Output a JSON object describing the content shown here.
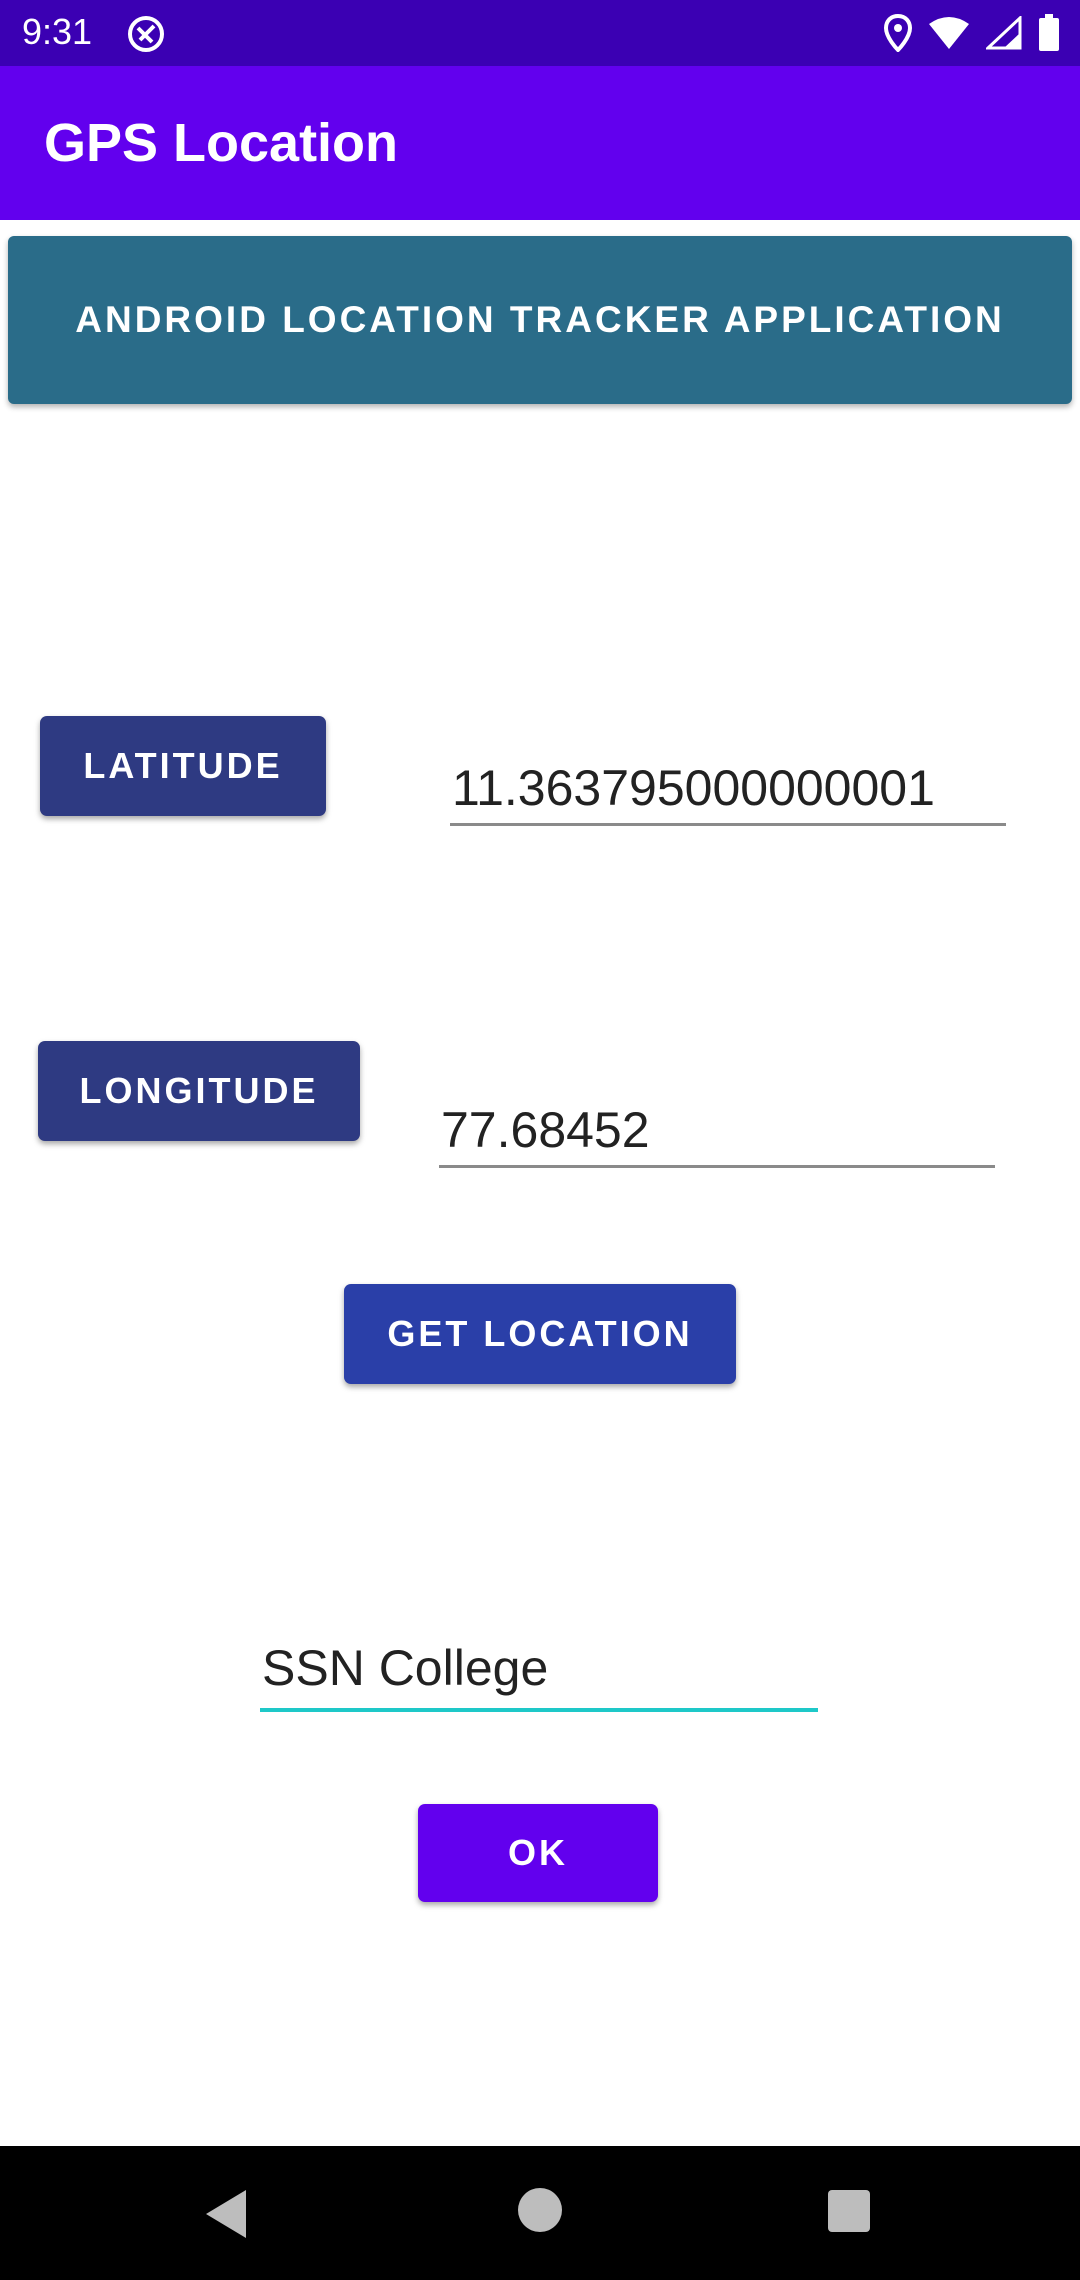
{
  "status_bar": {
    "time": "9:31",
    "icons": [
      "app-notification-icon",
      "location-icon",
      "wifi-icon",
      "signal-icon",
      "battery-icon"
    ]
  },
  "app_bar": {
    "title": "GPS Location",
    "color": "#6200ee"
  },
  "banner": {
    "label": "ANDROID LOCATION TRACKER APPLICATION",
    "color": "#2a6c89"
  },
  "latitude": {
    "button_label": "LATITUDE",
    "value": "11.363795000000001"
  },
  "longitude": {
    "button_label": "LONGITUDE",
    "value": "77.68452"
  },
  "get_location": {
    "label": "GET LOCATION"
  },
  "place": {
    "value": "SSN College"
  },
  "ok": {
    "label": "OK"
  },
  "nav_bar": {
    "icons": [
      "back-icon",
      "home-icon",
      "recents-icon"
    ]
  }
}
